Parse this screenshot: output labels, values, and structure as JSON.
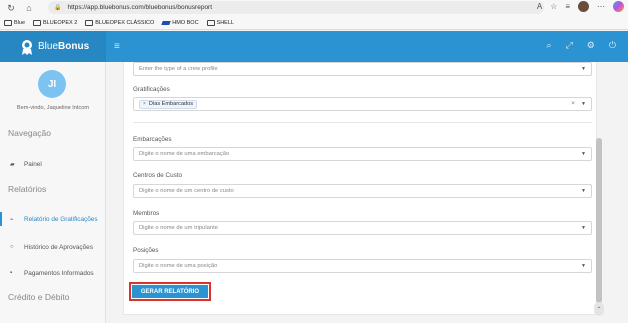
{
  "browser": {
    "url": "https://app.bluebonus.com/bluebonus/bonusreport",
    "bookmarks": [
      "Blue",
      "BLUEOPEX 2",
      "BLUEOPEX CLÁSSICO",
      "HMO BOC",
      "SHELL"
    ]
  },
  "app": {
    "brand_prefix": "Blue",
    "brand_suffix": "Bonus"
  },
  "sidebar": {
    "avatar_initials": "JI",
    "welcome": "Bem-vindo, Jaqueline Intcom",
    "section_nav": "Navegação",
    "item_panel": "Painel",
    "section_reports": "Relatórios",
    "item_bonus_report": "Relatório de Gratificações",
    "item_approval_history": "Histórico de Aprovações",
    "item_payments": "Pagamentos Informados",
    "section_credit": "Crédito e Débito"
  },
  "form": {
    "crew_profile_placeholder": "Enter the type of a crew profile",
    "bonus_label": "Gratificações",
    "bonus_tag": "Dias Embarcados",
    "vessels_label": "Embarcações",
    "vessels_placeholder": "Digite o nome de uma embarcação",
    "cost_centers_label": "Centros de Custo",
    "cost_centers_placeholder": "Digite o nome de um centro de custo",
    "members_label": "Membros",
    "members_placeholder": "Digite o nome de um tripulante",
    "positions_label": "Posições",
    "positions_placeholder": "Digite o nome de uma posição",
    "generate_button": "GERAR RELATÓRIO"
  }
}
